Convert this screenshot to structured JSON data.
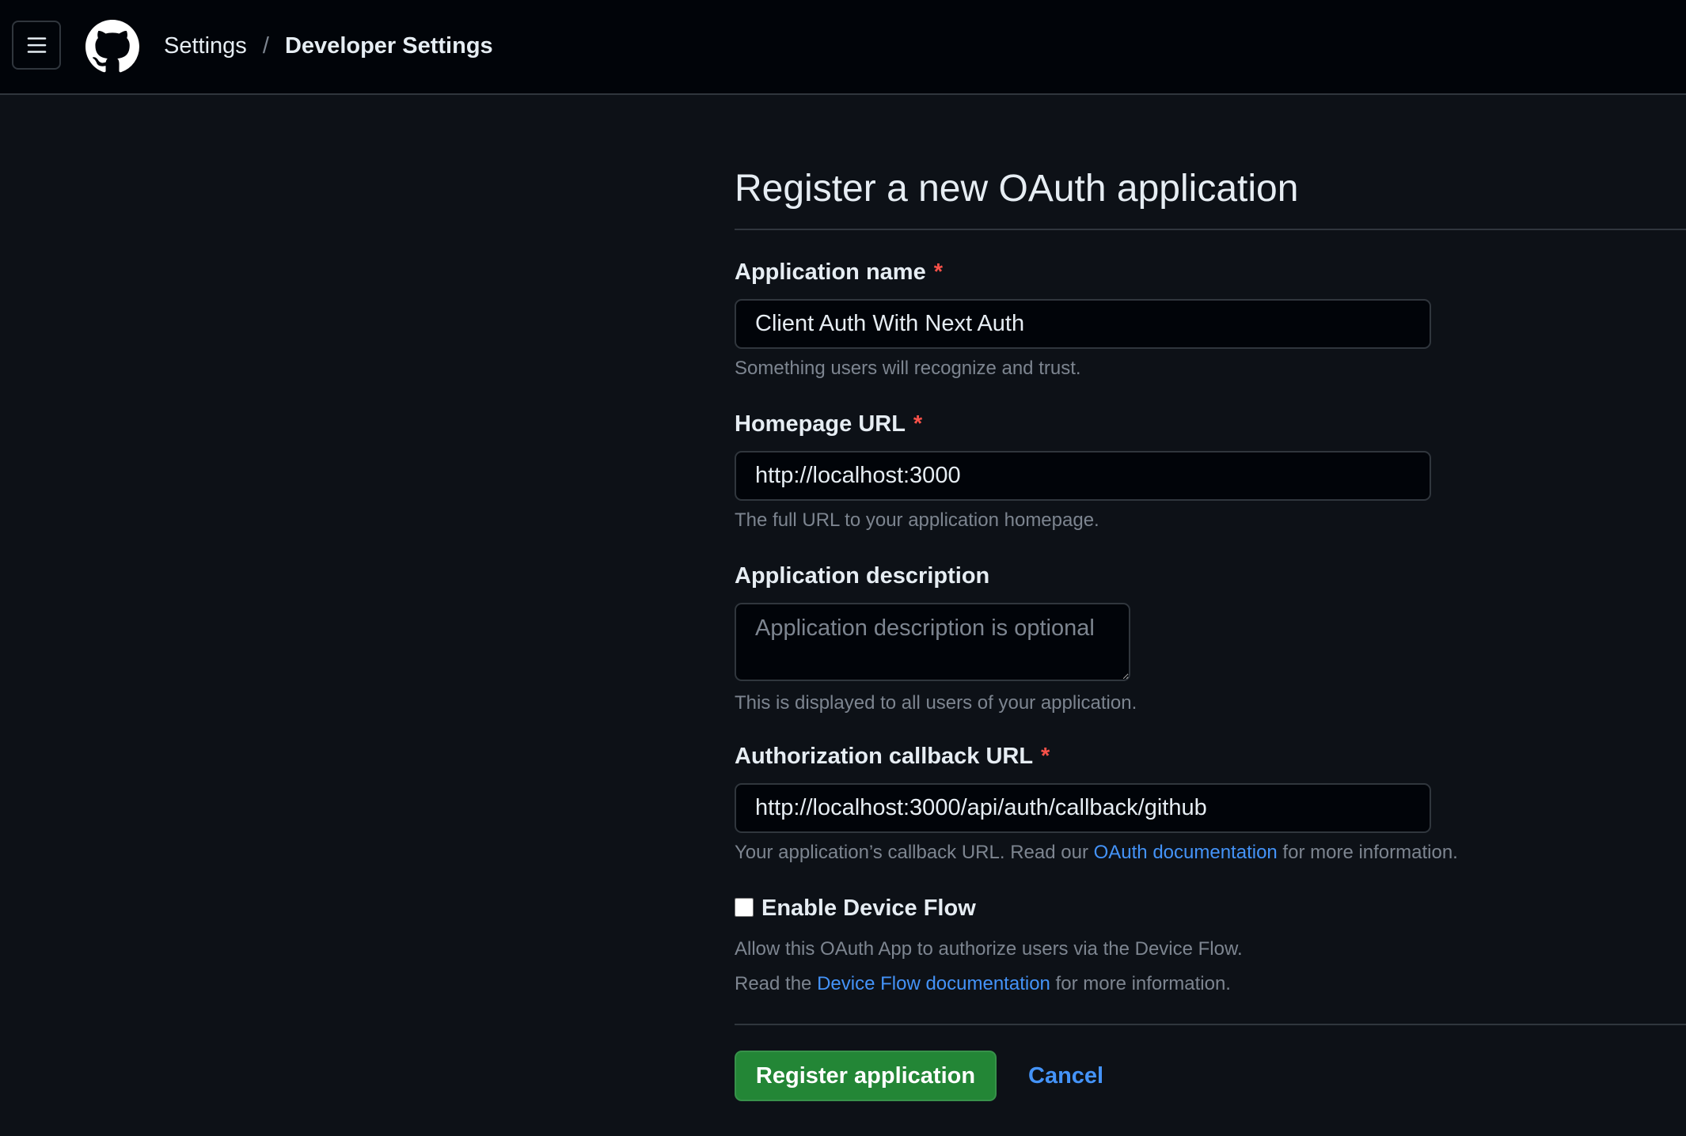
{
  "header": {
    "menu_icon": "hamburger-icon",
    "logo_icon": "github-logo-icon",
    "breadcrumb": {
      "parent": "Settings",
      "separator": "/",
      "current": "Developer Settings"
    }
  },
  "form": {
    "title": "Register a new OAuth application",
    "required_marker": "*",
    "app_name": {
      "label": "Application name",
      "value": "Client Auth With Next Auth",
      "help": "Something users will recognize and trust."
    },
    "homepage_url": {
      "label": "Homepage URL",
      "value": "http://localhost:3000",
      "help": "The full URL to your application homepage."
    },
    "description": {
      "label": "Application description",
      "placeholder": "Application description is optional",
      "help": "This is displayed to all users of your application."
    },
    "callback_url": {
      "label": "Authorization callback URL",
      "value": "http://localhost:3000/api/auth/callback/github",
      "help_before": "Your application’s callback URL. Read our ",
      "help_link": "OAuth documentation",
      "help_after": " for more information."
    },
    "device_flow": {
      "label": "Enable Device Flow",
      "checked": false,
      "help_line1": "Allow this OAuth App to authorize users via the Device Flow.",
      "help_line2_before": "Read the ",
      "help_line2_link": "Device Flow documentation",
      "help_line2_after": " for more information."
    },
    "submit_label": "Register application",
    "cancel_label": "Cancel"
  },
  "colors": {
    "background": "#0d1117",
    "header_background": "#010409",
    "border": "#30363d",
    "text": "#e6edf3",
    "muted": "#7d8590",
    "link": "#4493f8",
    "required": "#f85149",
    "primary_button": "#238636"
  }
}
